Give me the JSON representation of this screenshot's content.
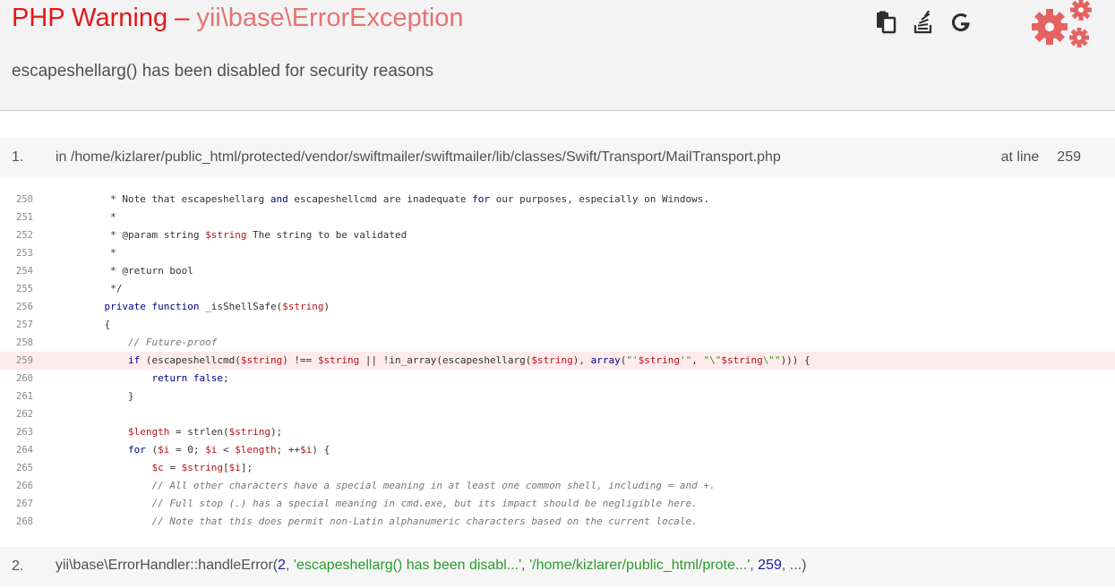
{
  "header": {
    "title_type": "PHP Warning",
    "title_sep": "–",
    "title_class": "yii\\base\\ErrorException",
    "message": "escapeshellarg() has been disabled for security reasons",
    "tools": [
      "copy-icon",
      "stackoverflow-icon",
      "google-icon"
    ],
    "logo": "gears-icon"
  },
  "call1": {
    "num": "1.",
    "file": "in /home/kizlarer/public_html/protected/vendor/swiftmailer/swiftmailer/lib/classes/Swift/Transport/MailTransport.php",
    "at_line_label": "at line",
    "line": "259"
  },
  "code": {
    "highlight_line": "259",
    "lines": [
      {
        "n": "250",
        "text": "     * Note that escapeshellarg and escapeshellcmd are inadequate for our purposes, especially on Windows."
      },
      {
        "n": "251",
        "text": "     *"
      },
      {
        "n": "252",
        "text": "     * @param string $string The string to be validated"
      },
      {
        "n": "253",
        "text": "     *"
      },
      {
        "n": "254",
        "text": "     * @return bool"
      },
      {
        "n": "255",
        "text": "     */"
      },
      {
        "n": "256",
        "text": "    private function _isShellSafe($string)"
      },
      {
        "n": "257",
        "text": "    {"
      },
      {
        "n": "258",
        "text": "        // Future-proof"
      },
      {
        "n": "259",
        "text": "        if (escapeshellcmd($string) !== $string || !in_array(escapeshellarg($string), array(\"'$string'\", \"\\\"$string\\\"\"))) {"
      },
      {
        "n": "260",
        "text": "            return false;"
      },
      {
        "n": "261",
        "text": "        }"
      },
      {
        "n": "262",
        "text": ""
      },
      {
        "n": "263",
        "text": "        $length = strlen($string);"
      },
      {
        "n": "264",
        "text": "        for ($i = 0; $i < $length; ++$i) {"
      },
      {
        "n": "265",
        "text": "            $c = $string[$i];"
      },
      {
        "n": "266",
        "text": "            // All other characters have a special meaning in at least one common shell, including = and +."
      },
      {
        "n": "267",
        "text": "            // Full stop (.) has a special meaning in cmd.exe, but its impact should be negligible here."
      },
      {
        "n": "268",
        "text": "            // Note that this does permit non-Latin alphanumeric characters based on the current locale."
      }
    ]
  },
  "call2": {
    "num": "2.",
    "func": "yii\\base\\ErrorHandler::handleError(",
    "arg1": "2",
    "arg2": "'escapeshellarg() has been disabl...'",
    "arg3": "'/home/kizlarer/public_html/prote...'",
    "arg4": "259",
    "rest": "...)"
  }
}
